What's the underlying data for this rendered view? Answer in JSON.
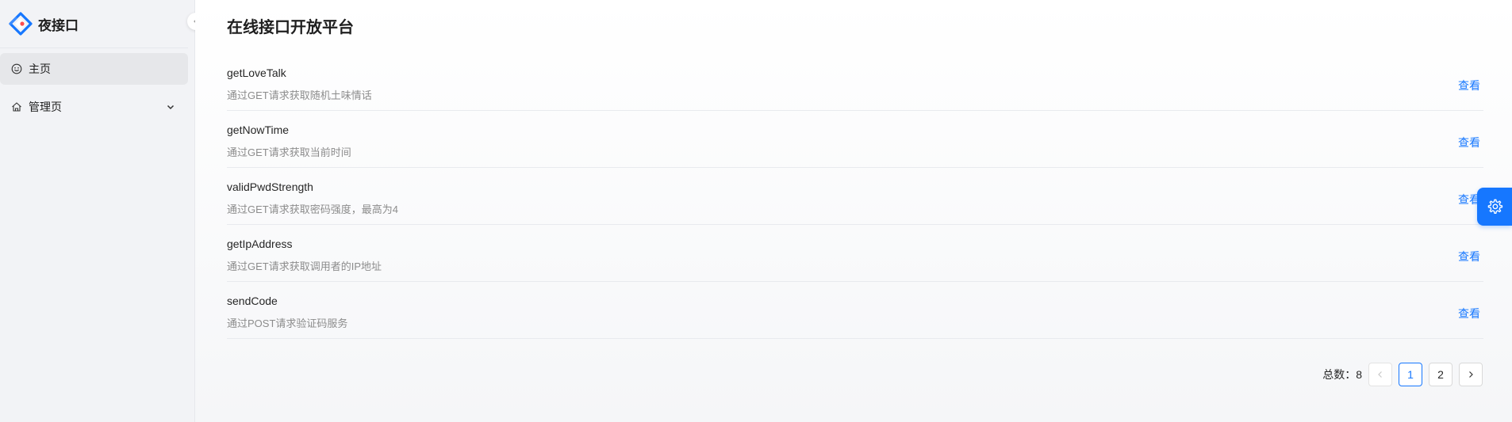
{
  "brand": {
    "name": "夜接口"
  },
  "sidebar": {
    "items": [
      {
        "label": "主页",
        "icon": "smile-icon"
      },
      {
        "label": "管理页",
        "icon": "home-icon"
      }
    ]
  },
  "page": {
    "title": "在线接口开放平台"
  },
  "apis": [
    {
      "name": "getLoveTalk",
      "desc": "通过GET请求获取随机土味情话",
      "action": "查看"
    },
    {
      "name": "getNowTime",
      "desc": "通过GET请求获取当前时间",
      "action": "查看"
    },
    {
      "name": "validPwdStrength",
      "desc": "通过GET请求获取密码强度，最高为4",
      "action": "查看"
    },
    {
      "name": "getIpAddress",
      "desc": "通过GET请求获取调用者的IP地址",
      "action": "查看"
    },
    {
      "name": "sendCode",
      "desc": "通过POST请求验证码服务",
      "action": "查看"
    }
  ],
  "pagination": {
    "total_label": "总数：8",
    "pages": [
      "1",
      "2"
    ],
    "current": "1"
  },
  "colors": {
    "accent": "#1677ff"
  }
}
